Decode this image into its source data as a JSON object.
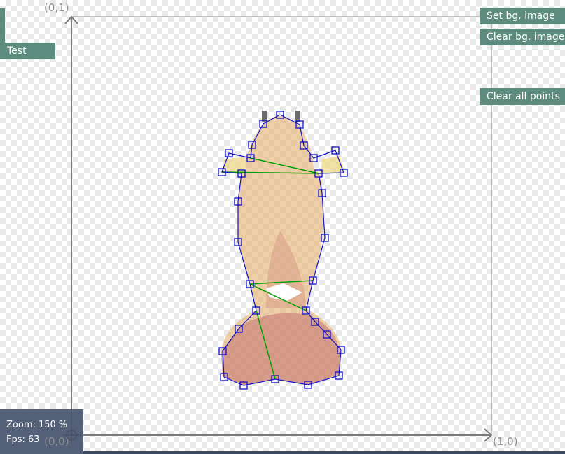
{
  "buttons": {
    "set_bg": "Set bg. image",
    "clear_bg": "Clear bg. image",
    "clear_all": "Clear all points",
    "test": "Test"
  },
  "axis_labels": {
    "top_left": "(0,1)",
    "origin": "(0,0)",
    "bottom_right": "(1,0)"
  },
  "status": {
    "zoom": "Zoom: 150 %",
    "fps": "Fps: 63"
  },
  "colors": {
    "button": "#5d8b7d",
    "outline": "#1010c8",
    "edges": "#00a000",
    "axis": "#7a7a7a",
    "origin_marker": "#8b1a2e"
  },
  "icons": {
    "origin": "crosshair-icon"
  }
}
